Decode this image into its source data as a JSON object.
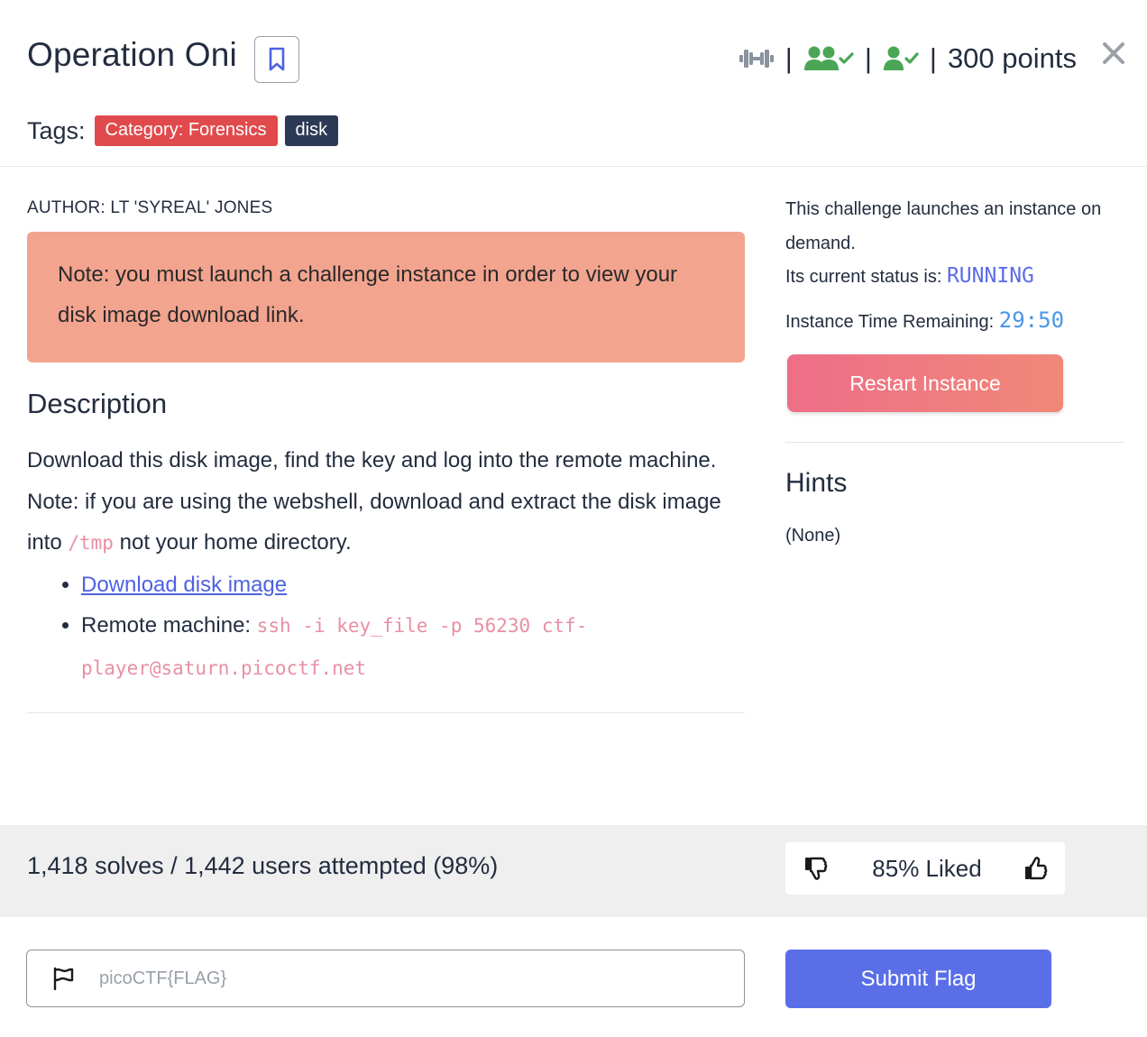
{
  "challenge": {
    "title": "Operation Oni",
    "points_text": "300 points"
  },
  "tags": {
    "label": "Tags:",
    "items": [
      "Category: Forensics",
      "disk"
    ]
  },
  "content": {
    "author": "AUTHOR: LT 'SYREAL' JONES",
    "note": "Note: you must launch a challenge instance in order to view your disk image download link.",
    "description_title": "Description",
    "description_p1": "Download this disk image, find the key and log into the remote machine.",
    "description_p2_before": "Note: if you are using the webshell, download and extract the disk image into ",
    "description_p2_code": "/tmp",
    "description_p2_after": " not your home directory.",
    "download_link": "Download disk image",
    "remote_label": "Remote machine: ",
    "remote_command": "ssh -i key_file -p 56230 ctf-player@saturn.picoctf.net"
  },
  "instance": {
    "launch_text": "This challenge launches an instance on demand.",
    "status_label": "Its current status is: ",
    "status_value": "RUNNING",
    "time_label": "Instance Time Remaining: ",
    "time_value": "29:50",
    "restart_label": "Restart Instance"
  },
  "hints": {
    "title": "Hints",
    "value": "(None)"
  },
  "stats": {
    "solves_text": "1,418 solves / 1,442 users attempted (98%)",
    "liked_text": "85% Liked"
  },
  "flag": {
    "placeholder": "picoCTF{FLAG}",
    "submit_label": "Submit Flag"
  },
  "icons": {
    "difficulty": "dumbbell-icon",
    "solved_by_team": "users-check-icon",
    "solved_by_user": "user-check-icon",
    "bookmark": "bookmark-icon",
    "close": "close-icon",
    "dislike": "thumbs-down-icon",
    "like": "thumbs-up-icon",
    "flag": "flag-icon"
  },
  "colors": {
    "accent_blue": "#5a6ee8",
    "tag_category": "#e04a4c",
    "tag_dark": "#2d3a55",
    "note_bg": "#f3a48f",
    "solved_green": "#4aa654",
    "status_blue": "#5b6ce6"
  }
}
